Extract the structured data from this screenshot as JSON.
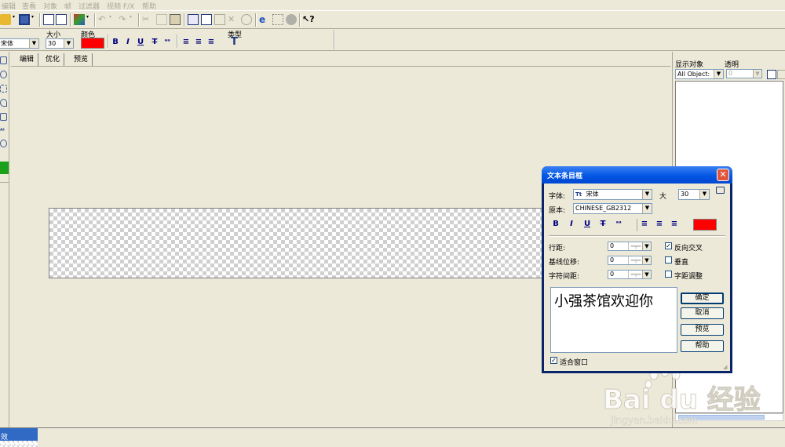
{
  "menu": [
    "编辑",
    "查看",
    "对象",
    "帧",
    "过滤器",
    "视频 F/X",
    "帮助"
  ],
  "format_toolbar": {
    "font_value": "宋体",
    "size_label": "大小",
    "size_value": "30",
    "color_label": "颜色",
    "color_value": "#ff0000",
    "type_label": "类型",
    "type_icon": "T"
  },
  "tabs": [
    "编辑",
    "优化",
    "预览"
  ],
  "right_panel": {
    "show_label": "显示对象",
    "opacity_label": "透明",
    "show_value": "All Object:",
    "opacity_value": "0"
  },
  "bottom_tab": "效",
  "dialog": {
    "title": "文本条目框",
    "font_label": "字体:",
    "font_icon": "Tt",
    "font_value": "宋体",
    "size_label": "大",
    "size_value": "30",
    "script_label": "原本:",
    "script_value": "CHINESE_GB2312",
    "format_buttons": [
      "B",
      "I",
      "U",
      "T"
    ],
    "color_value": "#ff0000",
    "line_spacing_label": "行距:",
    "line_spacing_value": "0",
    "baseline_label": "基线位移:",
    "baseline_value": "0",
    "char_spacing_label": "字符间距:",
    "char_spacing_value": "0",
    "reverse_label": "反向交叉",
    "reverse_checked": true,
    "vertical_label": "垂直",
    "vertical_checked": false,
    "kerning_label": "字距调整",
    "kerning_checked": false,
    "preview_text": "小强茶馆欢迎你",
    "ok_label": "确定",
    "cancel_label": "取消",
    "preview_label": "预览",
    "help_label": "帮助",
    "fit_window_label": "适合窗口",
    "fit_window_checked": true
  },
  "watermark": {
    "brand": "Bai du 经验",
    "url": "jingyan.baidu.com"
  }
}
